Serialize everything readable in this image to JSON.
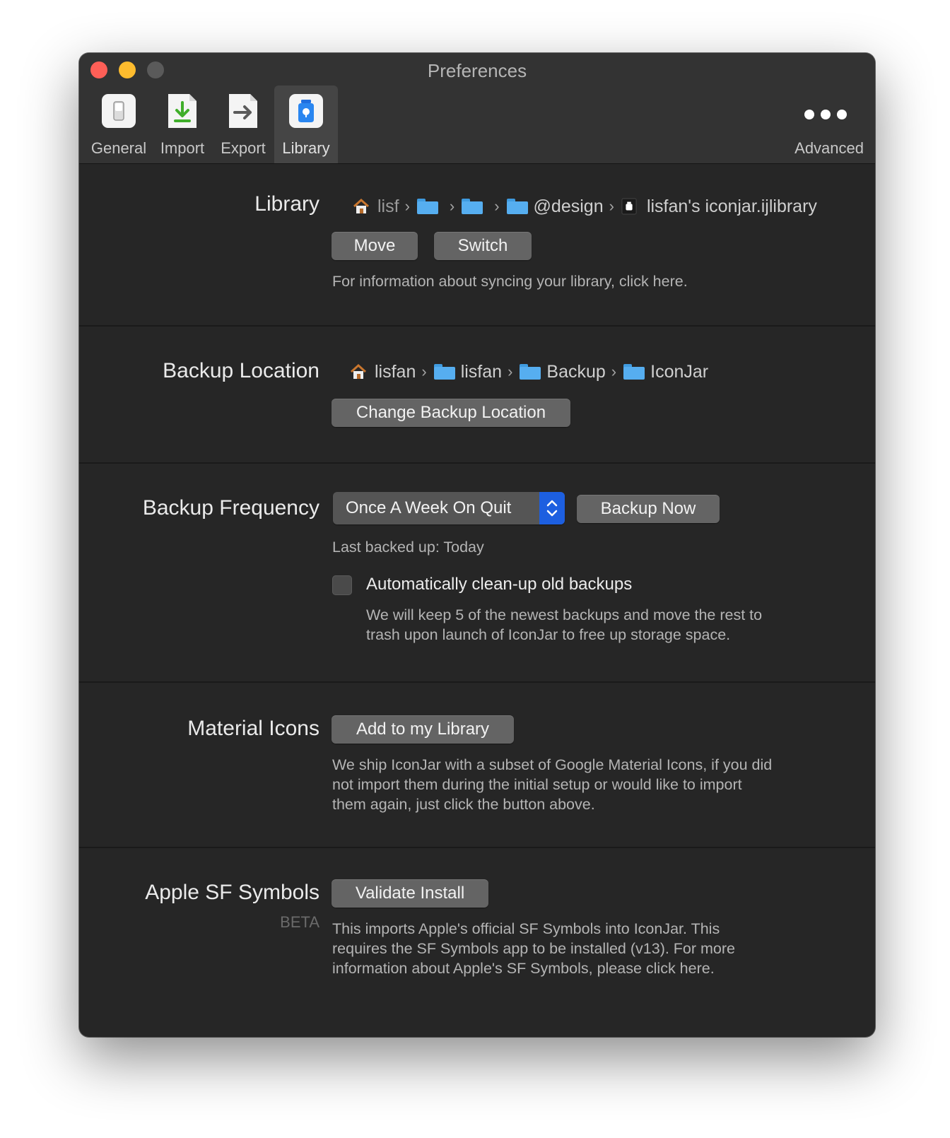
{
  "window": {
    "title": "Preferences"
  },
  "toolbar": {
    "tabs": [
      {
        "label": "General",
        "icon": "switch-icon"
      },
      {
        "label": "Import",
        "icon": "import-arrow-icon"
      },
      {
        "label": "Export",
        "icon": "export-arrow-icon"
      },
      {
        "label": "Library",
        "icon": "jar-icon",
        "active": true
      }
    ],
    "advanced_label": "Advanced"
  },
  "library": {
    "label": "Library",
    "path": {
      "home": "lisf",
      "folder4": "@design",
      "file": "lisfan's iconjar.ijlibrary"
    },
    "move_label": "Move",
    "switch_label": "Switch",
    "info": "For information about syncing your library, click here."
  },
  "backup_location": {
    "label": "Backup Location",
    "path": [
      "lisfan",
      "lisfan",
      "Backup",
      "IconJar"
    ],
    "change_label": "Change Backup Location"
  },
  "backup_frequency": {
    "label": "Backup Frequency",
    "selected": "Once A Week On Quit",
    "backup_now_label": "Backup Now",
    "last_backed_up": "Last backed up: Today",
    "cleanup_label": "Automatically clean-up old backups",
    "cleanup_checked": false,
    "cleanup_desc_1": "We will keep 5 of the newest backups and move the rest to",
    "cleanup_desc_2": "trash upon launch of IconJar to free up storage space."
  },
  "material_icons": {
    "label": "Material Icons",
    "add_label": "Add to my Library",
    "desc_1": "We ship IconJar with a subset of Google Material Icons, if you did",
    "desc_2": "not import them during the initial setup or would like to import",
    "desc_3": "them again, just click the button above."
  },
  "sf_symbols": {
    "label": "Apple SF Symbols",
    "badge": "BETA",
    "validate_label": "Validate Install",
    "desc_1": "This imports Apple's official SF Symbols into IconJar. This",
    "desc_2": "requires the SF Symbols app to be installed (v13). For more",
    "desc_3": "information about Apple's SF Symbols, please click here."
  },
  "colors": {
    "window_bg": "#262626",
    "accent_blue": "#1d5fe0",
    "close": "#fe5f57",
    "minimize": "#febc2e"
  }
}
